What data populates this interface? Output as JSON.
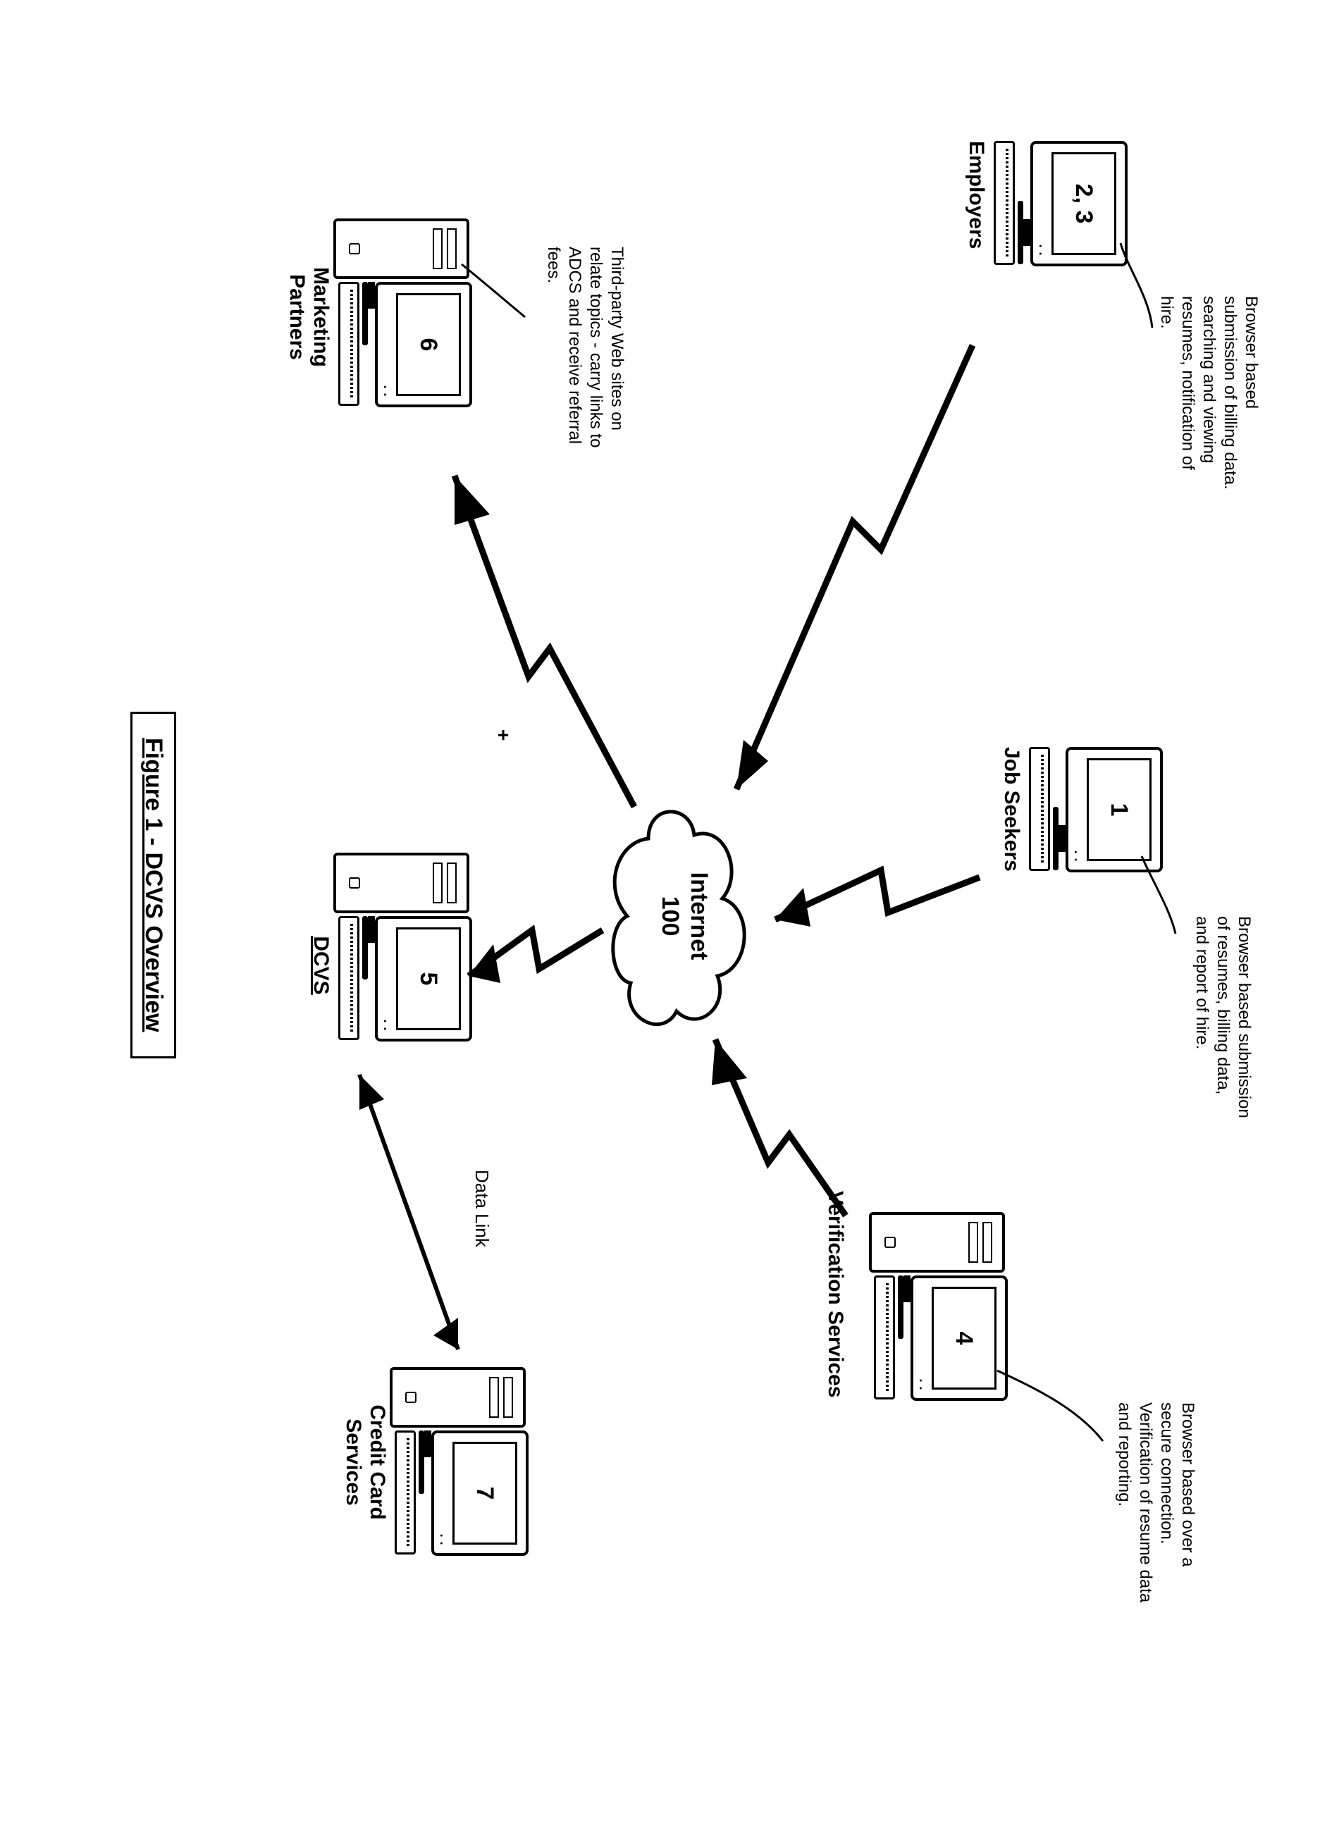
{
  "figure_title": "Figure 1 - DCVS Overview",
  "cloud": {
    "line1": "Internet",
    "line2": "100"
  },
  "data_link_label": "Data Link",
  "nodes": {
    "employers": {
      "label": "Employers",
      "num": "2, 3"
    },
    "jobseekers": {
      "label": "Job Seekers",
      "num": "1"
    },
    "verif": {
      "label": "Verification Services",
      "num": "4"
    },
    "dcvs": {
      "label": "DCVS",
      "num": "5"
    },
    "marketing": {
      "label": "Marketing Partners",
      "num": "6"
    },
    "credit": {
      "label": "Credit Card Services",
      "num": "7"
    }
  },
  "callouts": {
    "employers": "Browser based submission of billing data. searching  and viewing resumes, notification of hire.",
    "jobseekers": "Browser based submission of resumes, billing data, and report of hire.",
    "verif": "Browser based over a secure connection. Verification of resume data and reporting.",
    "marketing": "Third-party Web sites on relate topics - carry links to ADCS and receive referral fees."
  }
}
